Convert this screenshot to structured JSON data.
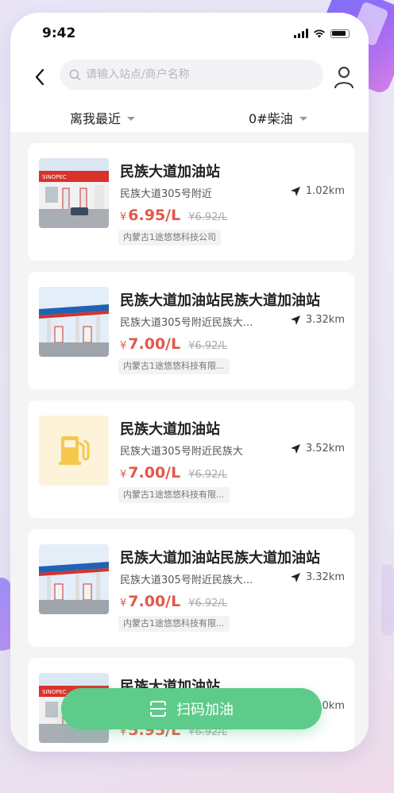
{
  "status_bar": {
    "time": "9:42"
  },
  "header": {
    "search_placeholder": "请输入站点/商户名称"
  },
  "filters": {
    "sort": "离我最近",
    "fuel_type": "0#柴油"
  },
  "stations": [
    {
      "name": "民族大道加油站",
      "address": "民族大道305号附近",
      "distance": "1.02km",
      "currency": "¥",
      "price": "6.95/L",
      "original_price": "¥6.92/L",
      "company": "内蒙古1途悠悠科技公司",
      "image": "sinopec-station-photo"
    },
    {
      "name": "民族大道加油站民族大道加油站",
      "address": "民族大道305号附近民族大...",
      "distance": "3.32km",
      "currency": "¥",
      "price": "7.00/L",
      "original_price": "¥6.92/L",
      "company": "内蒙古1途悠悠科技有限...",
      "image": "petrochina-station-photo"
    },
    {
      "name": "民族大道加油站",
      "address": "民族大道305号附近民族大",
      "distance": "3.52km",
      "currency": "¥",
      "price": "7.00/L",
      "original_price": "¥6.92/L",
      "company": "内蒙古1途悠悠科技有限...",
      "image": "fuel-pump-placeholder-icon"
    },
    {
      "name": "民族大道加油站民族大道加油站",
      "address": "民族大道305号附近民族大...",
      "distance": "3.32km",
      "currency": "¥",
      "price": "7.00/L",
      "original_price": "¥6.92/L",
      "company": "内蒙古1途悠悠科技有限...",
      "image": "petrochina-station-photo"
    },
    {
      "name": "民族大道加油站",
      "address": "",
      "distance": "0km",
      "currency": "¥",
      "price": "5.95/L",
      "original_price": "¥6.92/L",
      "company": "",
      "image": "sinopec-station-photo"
    }
  ],
  "scan_button": {
    "label": "扫码加油"
  },
  "colors": {
    "accent_green": "#5dcb8a",
    "price_red": "#e2574c",
    "placeholder_yellow": "#fdf3d9"
  }
}
